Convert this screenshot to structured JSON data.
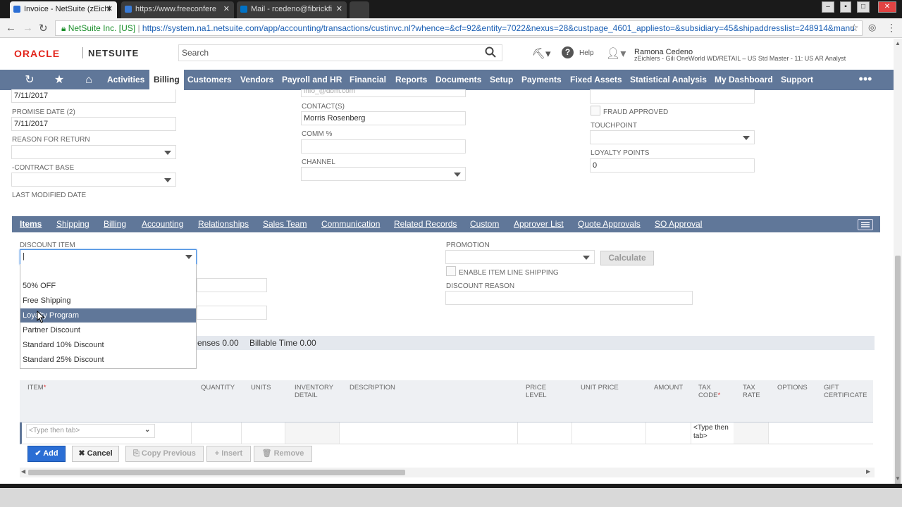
{
  "browser": {
    "tabs": [
      {
        "title": "Invoice - NetSuite (zEichl",
        "color": "#2b6ed4"
      },
      {
        "title": "https://www.freeconfere",
        "color": "#3a7bd5"
      },
      {
        "title": "Mail - rcedeno@fibrickfi",
        "color": "#0072c6"
      }
    ],
    "url_secure": "NetSuite Inc. [US]",
    "url": "https://system.na1.netsuite.com/app/accounting/transactions/custinvc.nl?whence=&cf=92&entity=7022&nexus=28&custpage_4601_appliesto=&subsidiary=45&shipaddresslist=248914&manu"
  },
  "header": {
    "oracle": "ORACLE",
    "netsuite": "NETSUITE",
    "search_placeholder": "Search",
    "help": "Help",
    "user_name": "Ramona Cedeno",
    "user_role": "zEichlers - Gili OneWorld WD/RETAIL – US Std Master - 11: US AR Analyst"
  },
  "nav": [
    "Activities",
    "Billing",
    "Customers",
    "Vendors",
    "Payroll and HR",
    "Financial",
    "Reports",
    "Documents",
    "Setup",
    "Payments",
    "Fixed Assets",
    "Statistical Analysis",
    "My Dashboard",
    "Support"
  ],
  "form": {
    "top_date": "7/11/2017",
    "promise_date_label": "PROMISE DATE (2)",
    "promise_date": "7/11/2017",
    "reason_for_return_label": "REASON FOR RETURN",
    "contract_base_label": "-CONTRACT BASE",
    "last_modified_label": "LAST MODIFIED DATE",
    "email_partial": "info_@dbm.com",
    "contacts_label": "CONTACT(S)",
    "contacts": "Morris Rosenberg",
    "comm_label": "COMM %",
    "channel_label": "CHANNEL",
    "fraud_label": "FRAUD APPROVED",
    "touchpoint_label": "TOUCHPOINT",
    "loyalty_label": "LOYALTY POINTS",
    "loyalty": "0"
  },
  "subtabs": [
    "Items",
    "Shipping",
    "Billing",
    "Accounting",
    "Relationships",
    "Sales Team",
    "Communication",
    "Related Records",
    "Custom",
    "Approver List",
    "Quote Approvals",
    "SO Approval"
  ],
  "items_tab": {
    "discount_label": "DISCOUNT ITEM",
    "discount_value": "|",
    "options": [
      "50% OFF",
      "Free Shipping",
      "Loyalty Program",
      "Partner Discount",
      "Standard 10% Discount",
      "Standard 25% Discount"
    ],
    "selected_option": "Loyalty Program",
    "promotion_label": "PROMOTION",
    "calculate": "Calculate",
    "enable_line_shipping": "ENABLE ITEM LINE SHIPPING",
    "discount_reason_label": "DISCOUNT REASON",
    "summary_expenses": "enses 0.00",
    "summary_billable": "Billable Time 0.00"
  },
  "grid": {
    "columns": [
      "ITEM",
      "QUANTITY",
      "UNITS",
      "INVENTORY DETAIL",
      "DESCRIPTION",
      "PRICE LEVEL",
      "UNIT PRICE",
      "AMOUNT",
      "TAX CODE",
      "TAX RATE",
      "OPTIONS",
      "GIFT CERTIFICATE"
    ],
    "item_placeholder": "<Type then tab>",
    "taxcode_placeholder": "<Type then tab>"
  },
  "buttons": {
    "add": "Add",
    "cancel": "Cancel",
    "copy_previous": "Copy Previous",
    "insert": "Insert",
    "remove": "Remove"
  }
}
